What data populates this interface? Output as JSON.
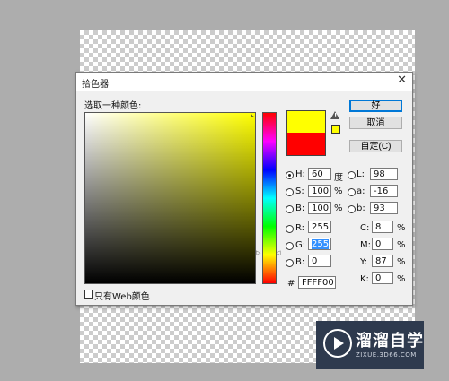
{
  "window": {
    "title": "拾色器",
    "close": "✕"
  },
  "picker": {
    "prompt": "选取一种颜色:",
    "web_only_label": "只有Web颜色"
  },
  "buttons": {
    "ok": "好",
    "cancel": "取消",
    "custom": "自定(C)"
  },
  "hsb": [
    {
      "label": "H:",
      "value": "60",
      "unit": "度",
      "selected": true
    },
    {
      "label": "S:",
      "value": "100",
      "unit": "%",
      "selected": false
    },
    {
      "label": "B:",
      "value": "100",
      "unit": "%",
      "selected": false
    }
  ],
  "lab": [
    {
      "label": "L:",
      "value": "98"
    },
    {
      "label": "a:",
      "value": "-16"
    },
    {
      "label": "b:",
      "value": "93"
    }
  ],
  "rgb": [
    {
      "label": "R:",
      "value": "255"
    },
    {
      "label": "G:",
      "value": "255"
    },
    {
      "label": "B:",
      "value": "0"
    }
  ],
  "cmyk": [
    {
      "label": "C:",
      "value": "8",
      "unit": "%"
    },
    {
      "label": "M:",
      "value": "0",
      "unit": "%"
    },
    {
      "label": "Y:",
      "value": "87",
      "unit": "%"
    },
    {
      "label": "K:",
      "value": "0",
      "unit": "%"
    }
  ],
  "hex": {
    "label": "#",
    "value": "FFFF00"
  },
  "colors": {
    "new": "#ffff00",
    "current": "#ff0000"
  },
  "watermark": {
    "title": "溜溜自学",
    "subtitle": "ZIXUE.3D66.COM"
  }
}
